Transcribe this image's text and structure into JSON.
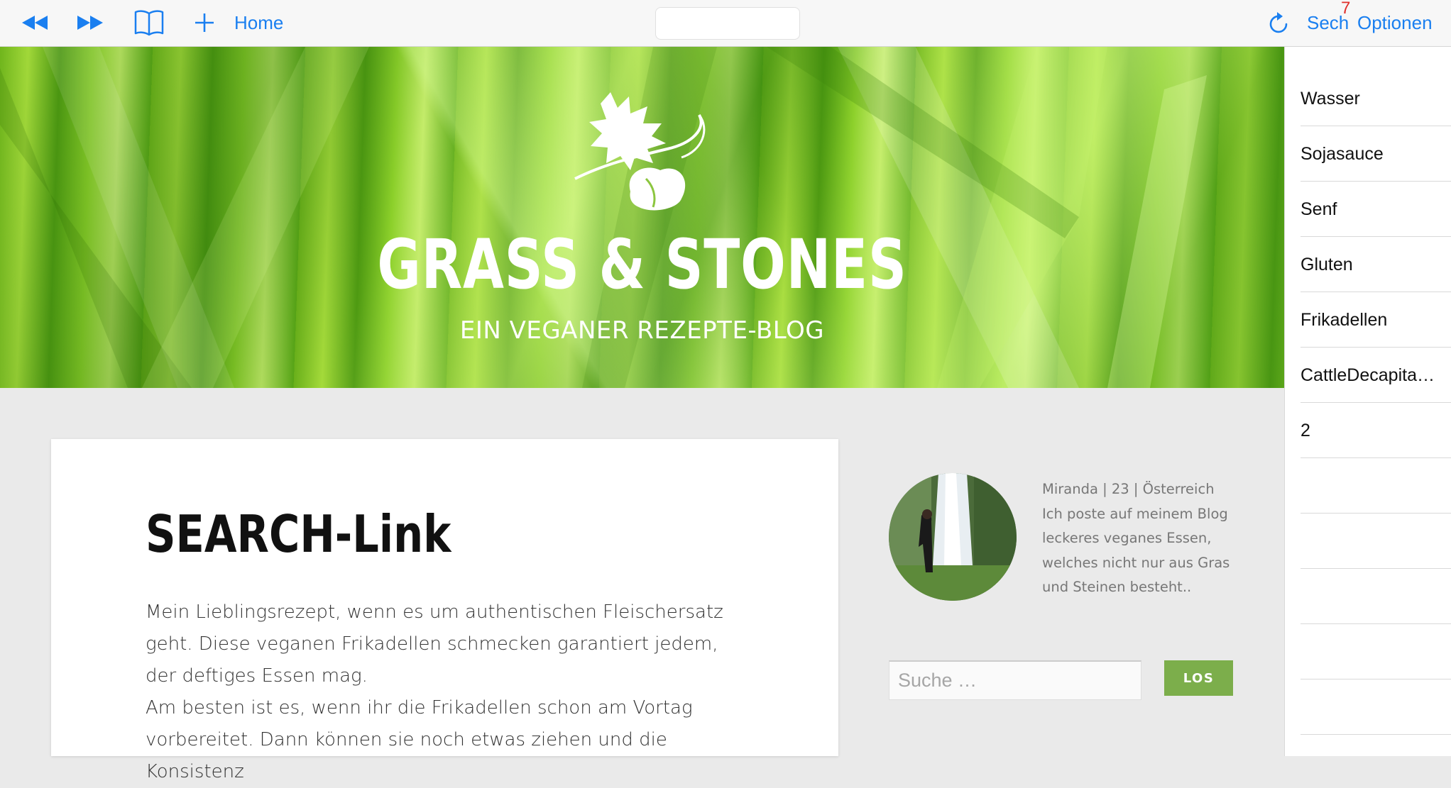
{
  "toolbar": {
    "home_label": "Home",
    "reload_icon": "reload-icon",
    "search_label": "Sech",
    "badge_count": "7",
    "options_label": "Optionen",
    "accent_color": "#1a7ff0",
    "badge_color": "#e0302b"
  },
  "hero": {
    "title": "GRASS & STONES",
    "subtitle": "EIN VEGANER REZEPTE-BLOG"
  },
  "side_panel": {
    "items": [
      "Wasser",
      "Sojasauce",
      "Senf",
      "Gluten",
      "Frikadellen",
      "CattleDecapita…",
      "2",
      "",
      "",
      "",
      "",
      "",
      ""
    ]
  },
  "post": {
    "title": "SEARCH-Link",
    "paragraph_1": "Mein Lieblingsrezept, wenn es um authentischen Fleischersatz geht. Diese veganen Frikadellen schmecken garantiert jedem, der deftiges Essen mag.",
    "paragraph_2": "Am besten ist es, wenn ihr die Frikadellen schon am Vortag vorbereitet. Dann können sie noch etwas ziehen und die Konsistenz"
  },
  "about": {
    "line_1": "Miranda | 23 | Österreich",
    "line_2": "Ich poste auf meinem Blog",
    "line_3": "leckeres veganes Essen,",
    "line_4": "welches nicht nur aus Gras",
    "line_5": "und Steinen besteht.."
  },
  "search": {
    "placeholder": "Suche …",
    "button_label": "LOS",
    "button_color": "#7cae4b"
  }
}
